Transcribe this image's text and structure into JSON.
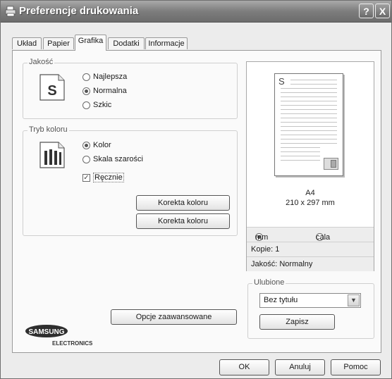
{
  "window": {
    "title": "Preferencje drukowania",
    "help_label": "?",
    "close_label": "X"
  },
  "tabs": [
    {
      "label": "Układ"
    },
    {
      "label": "Papier"
    },
    {
      "label": "Grafika"
    },
    {
      "label": "Dodatki"
    },
    {
      "label": "Informacje"
    }
  ],
  "active_tab": "Grafika",
  "quality": {
    "group_label": "Jakość",
    "options": [
      "Najlepsza",
      "Normalna",
      "Szkic"
    ],
    "selected": "Normalna",
    "icon_letter": "S"
  },
  "color_mode": {
    "group_label": "Tryb koloru",
    "options": [
      "Kolor",
      "Skala szarości"
    ],
    "selected": "Kolor",
    "manual_label": "Ręcznie",
    "manual_checked": true,
    "correction_button_1": "Korekta koloru",
    "correction_button_2": "Korekta koloru"
  },
  "advanced_button": "Opcje zaawansowane",
  "preview": {
    "page_letter": "S",
    "paper_name": "A4",
    "paper_size": "210 x 297 mm",
    "unit_options": [
      "mm",
      "cala"
    ],
    "unit_selected": "mm",
    "copies_text": "Kopie: 1",
    "quality_text": "Jakość: Normalny"
  },
  "favorites": {
    "group_label": "Ulubione",
    "selected_value": "Bez tytułu",
    "save_button": "Zapisz"
  },
  "logo": {
    "brand": "SAMSUNG",
    "sub": "ELECTRONICS"
  },
  "footer": {
    "ok": "OK",
    "cancel": "Anuluj",
    "help": "Pomoc"
  }
}
